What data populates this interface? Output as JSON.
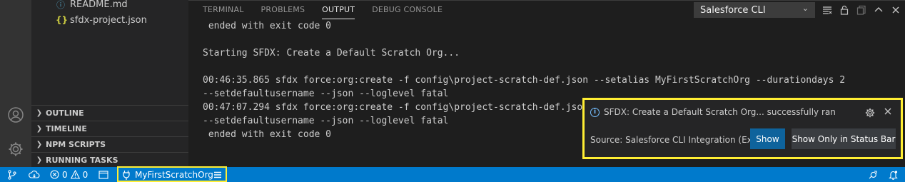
{
  "explorer": {
    "files": [
      {
        "name": "README.md",
        "icon": "info-circle-icon",
        "icon_glyph": "ⓘ",
        "icon_color": "#519aba"
      },
      {
        "name": "sfdx-project.json",
        "icon": "json-braces-icon",
        "icon_glyph": "{}",
        "icon_color": "#cbcb41"
      }
    ],
    "sections": [
      {
        "label": "OUTLINE"
      },
      {
        "label": "TIMELINE"
      },
      {
        "label": "NPM SCRIPTS"
      },
      {
        "label": "RUNNING TASKS"
      }
    ]
  },
  "activity_bar": {
    "account_icon": "account-icon",
    "settings_icon": "gear-icon"
  },
  "panel": {
    "tabs": [
      {
        "label": "TERMINAL",
        "active": false
      },
      {
        "label": "PROBLEMS",
        "active": false
      },
      {
        "label": "OUTPUT",
        "active": true
      },
      {
        "label": "DEBUG CONSOLE",
        "active": false
      }
    ],
    "output_channel": "Salesforce CLI",
    "actions": [
      "clear-output-icon",
      "lock-icon",
      "copy-icon",
      "chevron-up-icon",
      "close-icon"
    ],
    "output_lines": [
      " ended with exit code 0",
      "",
      "Starting SFDX: Create a Default Scratch Org...",
      "",
      "00:46:35.865 sfdx force:org:create -f config\\project-scratch-def.json --setalias MyFirstScratchOrg --durationdays 2",
      "--setdefaultusername --json --loglevel fatal",
      "00:47:07.294 sfdx force:org:create -f config\\project-scratch-def.json",
      "--setdefaultusername --json --loglevel fatal",
      " ended with exit code 0"
    ]
  },
  "notification": {
    "message": "SFDX: Create a Default Scratch Org... successfully ran",
    "source": "Source: Salesforce CLI Integration (Exte...",
    "primary_button": "Show",
    "secondary_button": "Show Only in Status Bar",
    "highlight_color": "#ffee33"
  },
  "status_bar": {
    "errors": "0",
    "warnings": "0",
    "org": "MyFirstScratchOrg",
    "color": "#007acc"
  }
}
